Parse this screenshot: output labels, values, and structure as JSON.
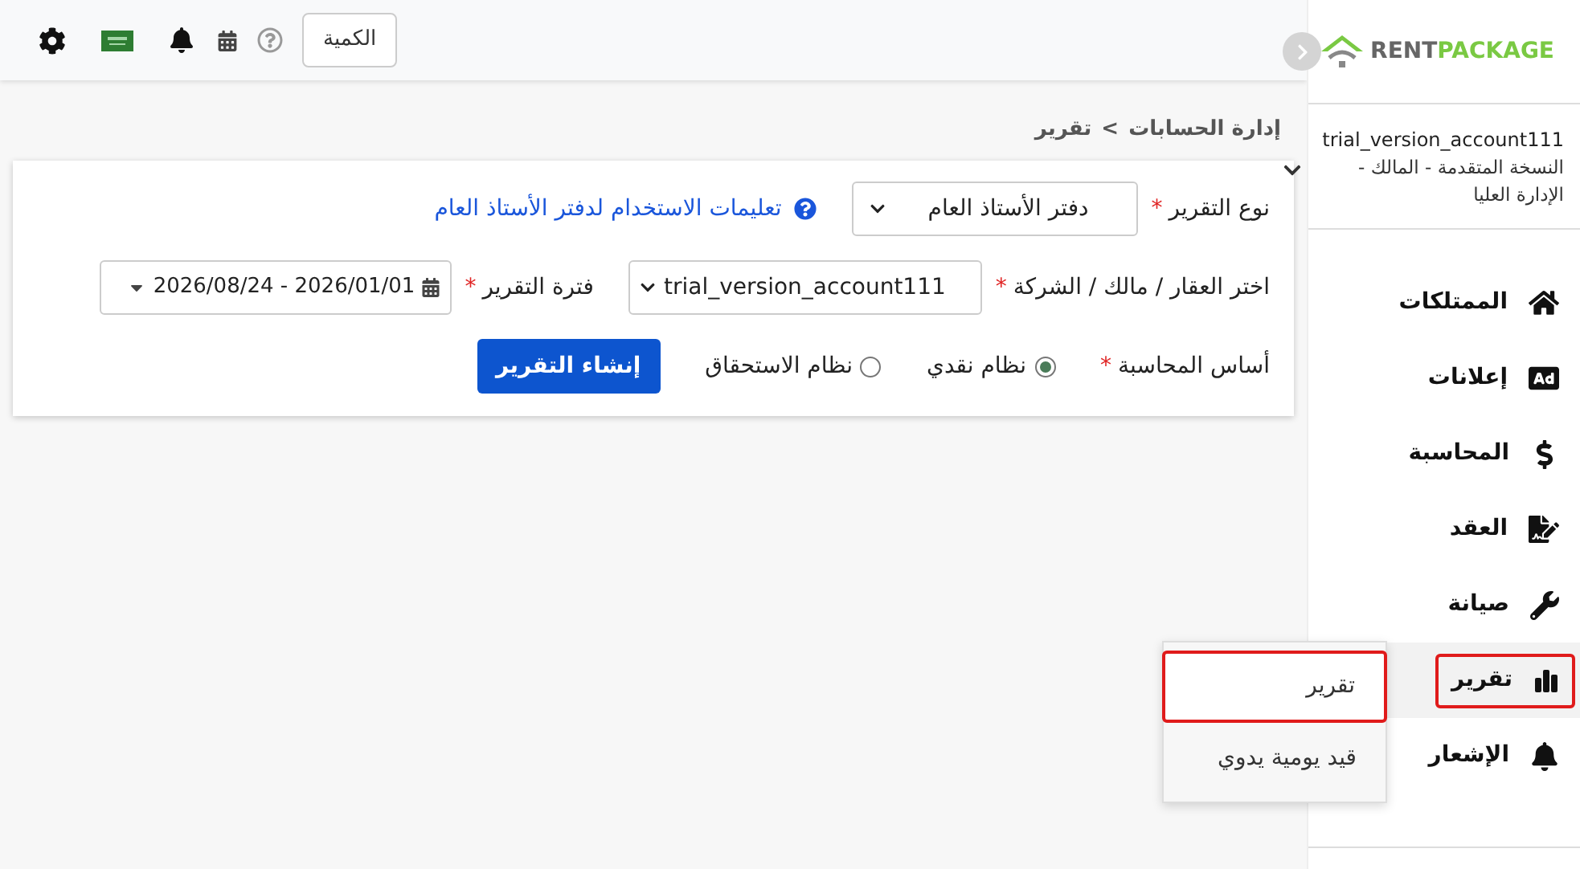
{
  "topbar": {
    "quantity_button": "الكمية"
  },
  "sidebar": {
    "logo": {
      "word_1": "RENT",
      "word_2": "PACKAGE"
    },
    "account": {
      "name": "trial_version_account111",
      "role": "النسخة المتقدمة - المالك - الإدارة العليا"
    },
    "items": [
      {
        "label": "الممتلكات",
        "selected": false
      },
      {
        "label": "إعلانات",
        "selected": false
      },
      {
        "label": "المحاسبة",
        "selected": false
      },
      {
        "label": "العقد",
        "selected": false
      },
      {
        "label": "صيانة",
        "selected": false
      },
      {
        "label": "تقرير",
        "selected": true
      },
      {
        "label": "الإشعار",
        "selected": false
      }
    ],
    "submenu": [
      {
        "label": "تقرير",
        "selected": true
      },
      {
        "label": "قيد يومية يدوي",
        "selected": false
      }
    ]
  },
  "breadcrumb": {
    "parent": "إدارة الحسابات",
    "separator": ">",
    "current": "تقرير"
  },
  "form": {
    "report_type": {
      "label": "نوع التقرير",
      "asterisk": "*",
      "value": "دفتر الأستاذ العام"
    },
    "help_link": "تعليمات الاستخدام لدفتر الأستاذ العام",
    "property": {
      "label": "اختر العقار / مالك / الشركة",
      "asterisk": "*",
      "value": "trial_version_account111"
    },
    "period": {
      "label": "فترة التقرير",
      "asterisk": "*",
      "value": "2026/01/01 - 2026/08/24"
    },
    "basis": {
      "label": "أساس المحاسبة",
      "asterisk": "*",
      "options": [
        {
          "label": "نظام نقدي",
          "selected": true
        },
        {
          "label": "نظام الاستحقاق",
          "selected": false
        }
      ]
    },
    "submit_button": "إنشاء التقرير"
  }
}
